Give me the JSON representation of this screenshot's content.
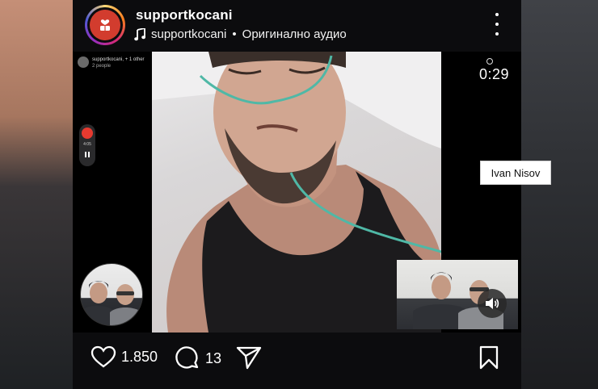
{
  "header": {
    "username": "supportkocani",
    "audio_account": "supportkocani",
    "audio_separator": "•",
    "audio_label": "Оригинално аудио",
    "avatar_icon": "hands-heart-icon",
    "more_icon": "more-vertical-icon"
  },
  "video": {
    "live_title": "supportkocani, + 1 other",
    "live_sub": "2 people",
    "rec_time": "4:05",
    "timer": "0:29",
    "volume_icon": "speaker-on-icon"
  },
  "overlay": {
    "name_label": "Ivan Nisov"
  },
  "actions": {
    "likes": "1.850",
    "comments": "13",
    "like_icon": "heart-icon",
    "comment_icon": "comment-icon",
    "share_icon": "send-icon",
    "save_icon": "bookmark-icon"
  },
  "colors": {
    "rec_red": "#e63a30",
    "avatar_red": "#d23c2e",
    "tube_green": "#4fb8a6"
  }
}
